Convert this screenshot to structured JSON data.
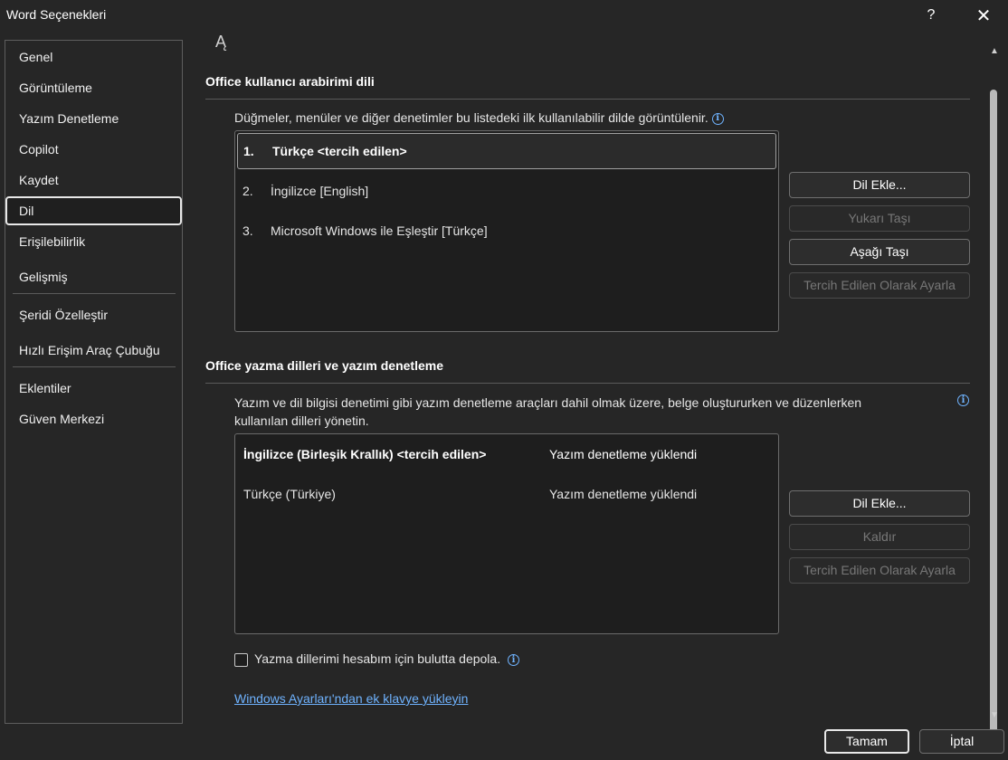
{
  "window": {
    "title": "Word Seçenekleri",
    "help_label": "?",
    "close_label": "✕"
  },
  "sidebar": {
    "items": [
      {
        "label": "Genel"
      },
      {
        "label": "Görüntüleme"
      },
      {
        "label": "Yazım Denetleme"
      },
      {
        "label": "Copilot"
      },
      {
        "label": "Kaydet"
      },
      {
        "label": "Dil",
        "selected": true
      },
      {
        "label": "Erişilebilirlik"
      },
      {
        "label": "Gelişmiş"
      },
      {
        "label": "Şeridi Özelleştir"
      },
      {
        "label": "Hızlı Erişim Araç Çubuğu"
      },
      {
        "label": "Eklentiler"
      },
      {
        "label": "Güven Merkezi"
      }
    ]
  },
  "ui_language": {
    "title": "Office kullanıcı arabirimi dili",
    "description": "Düğmeler, menüler ve diğer denetimler bu listedeki ilk kullanılabilir dilde görüntülenir.",
    "languages": [
      {
        "num": "1.",
        "name": "Türkçe <tercih edilen>",
        "selected": true
      },
      {
        "num": "2.",
        "name": "İngilizce [English]"
      },
      {
        "num": "3.",
        "name": "Microsoft Windows ile Eşleştir [Türkçe]"
      }
    ],
    "buttons": {
      "add": "Dil Ekle...",
      "move_up": "Yukarı Taşı",
      "move_down": "Aşağı Taşı",
      "set_preferred": "Tercih Edilen Olarak Ayarla"
    }
  },
  "authoring": {
    "title": "Office yazma dilleri ve yazım denetleme",
    "description_line1": "Yazım ve dil bilgisi denetimi gibi yazım denetleme araçları dahil olmak üzere, belge oluştururken ve düzenlerken",
    "description_line2": "kullanılan dilleri yönetin.",
    "languages": [
      {
        "name": "İngilizce (Birleşik Krallık) <tercih edilen>",
        "status": "Yazım denetleme yüklendi",
        "selected": true
      },
      {
        "name": "Türkçe (Türkiye)",
        "status": "Yazım denetleme yüklendi"
      }
    ],
    "buttons": {
      "add": "Dil Ekle...",
      "remove": "Kaldır",
      "set_preferred": "Tercih Edilen Olarak Ayarla"
    },
    "cloud_checkbox_label": "Yazma dillerimi hesabım için bulutta depola.",
    "cloud_checkbox_checked": false,
    "keyboard_link": "Windows Ayarları'ndan ek klavye yükleyin"
  },
  "footer": {
    "ok": "Tamam",
    "cancel": "İptal"
  },
  "colors": {
    "background": "#262626",
    "link": "#6fb3ff",
    "info": "#6fb3ff"
  }
}
